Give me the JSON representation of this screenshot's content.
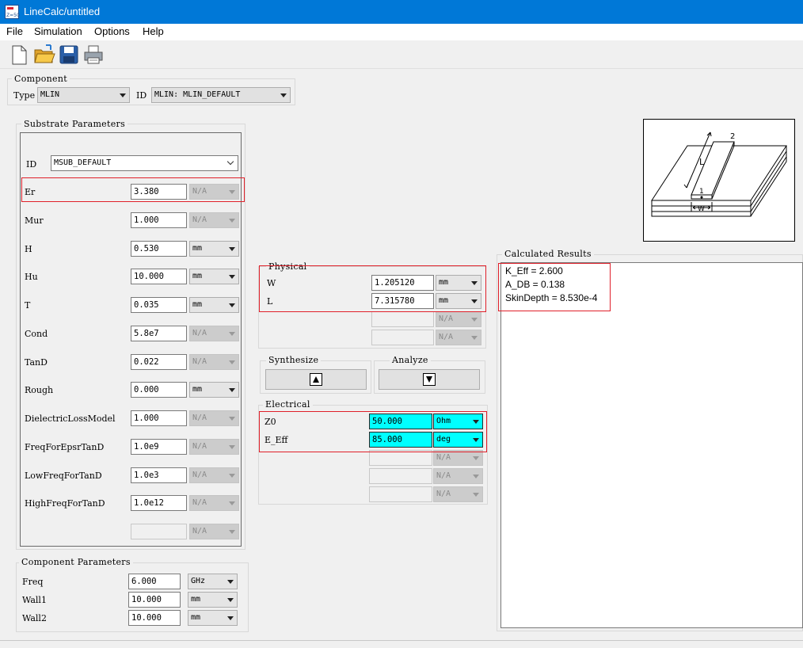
{
  "window": {
    "title": "LineCalc/untitled"
  },
  "menu": [
    "File",
    "Simulation",
    "Options",
    "Help"
  ],
  "toolbar": [
    "new-file-icon",
    "open-folder-icon",
    "save-icon",
    "print-icon"
  ],
  "component": {
    "title": "Component",
    "type_label": "Type",
    "type_value": "MLIN",
    "id_label": "ID",
    "id_value": "MLIN: MLIN_DEFAULT"
  },
  "substrate": {
    "title": "Substrate Parameters",
    "id_label": "ID",
    "id_value": "MSUB_DEFAULT",
    "rows": [
      {
        "label": "Er",
        "value": "3.380",
        "unit": "N/A",
        "enabled": false
      },
      {
        "label": "Mur",
        "value": "1.000",
        "unit": "N/A",
        "enabled": false
      },
      {
        "label": "H",
        "value": "0.530",
        "unit": "mm",
        "enabled": true
      },
      {
        "label": "Hu",
        "value": "10.000",
        "unit": "mm",
        "enabled": true
      },
      {
        "label": "T",
        "value": "0.035",
        "unit": "mm",
        "enabled": true
      },
      {
        "label": "Cond",
        "value": "5.8e7",
        "unit": "N/A",
        "enabled": false
      },
      {
        "label": "TanD",
        "value": "0.022",
        "unit": "N/A",
        "enabled": false
      },
      {
        "label": "Rough",
        "value": "0.000",
        "unit": "mm",
        "enabled": true
      },
      {
        "label": "DielectricLossModel",
        "value": "1.000",
        "unit": "N/A",
        "enabled": false
      },
      {
        "label": "FreqForEpsrTanD",
        "value": "1.0e9",
        "unit": "N/A",
        "enabled": false
      },
      {
        "label": "LowFreqForTanD",
        "value": "1.0e3",
        "unit": "N/A",
        "enabled": false
      },
      {
        "label": "HighFreqForTanD",
        "value": "1.0e12",
        "unit": "N/A",
        "enabled": false
      },
      {
        "label": "",
        "value": "",
        "unit": "N/A",
        "enabled": false
      }
    ]
  },
  "component_params": {
    "title": "Component Parameters",
    "rows": [
      {
        "label": "Freq",
        "value": "6.000",
        "unit": "GHz"
      },
      {
        "label": "Wall1",
        "value": "10.000",
        "unit": "mm"
      },
      {
        "label": "Wall2",
        "value": "10.000",
        "unit": "mm"
      }
    ]
  },
  "physical": {
    "title": "Physical",
    "rows": [
      {
        "label": "W",
        "value": "1.205120",
        "unit": "mm",
        "enabled": true
      },
      {
        "label": "L",
        "value": "7.315780",
        "unit": "mm",
        "enabled": true
      },
      {
        "label": "",
        "value": "",
        "unit": "N/A",
        "enabled": false
      },
      {
        "label": "",
        "value": "",
        "unit": "N/A",
        "enabled": false
      }
    ]
  },
  "synthesize": {
    "title": "Synthesize"
  },
  "analyze": {
    "title": "Analyze"
  },
  "electrical": {
    "title": "Electrical",
    "rows": [
      {
        "label": "Z0",
        "value": "50.000",
        "unit": "Ohm",
        "enabled": true
      },
      {
        "label": "E_Eff",
        "value": "85.000",
        "unit": "deg",
        "enabled": true
      },
      {
        "label": "",
        "value": "",
        "unit": "N/A",
        "enabled": false
      },
      {
        "label": "",
        "value": "",
        "unit": "N/A",
        "enabled": false
      },
      {
        "label": "",
        "value": "",
        "unit": "N/A",
        "enabled": false
      }
    ]
  },
  "results": {
    "title": "Calculated Results",
    "lines": [
      "K_Eff = 2.600",
      "A_DB = 0.138",
      "SkinDepth = 8.530e-4"
    ]
  },
  "diagram": {
    "label_L": "L",
    "label_W": "W",
    "label_1": "1",
    "label_2": "2"
  },
  "colors": {
    "titlebar": "#0078d7",
    "highlight": "#00ffff",
    "annotation": "#e0202a"
  }
}
